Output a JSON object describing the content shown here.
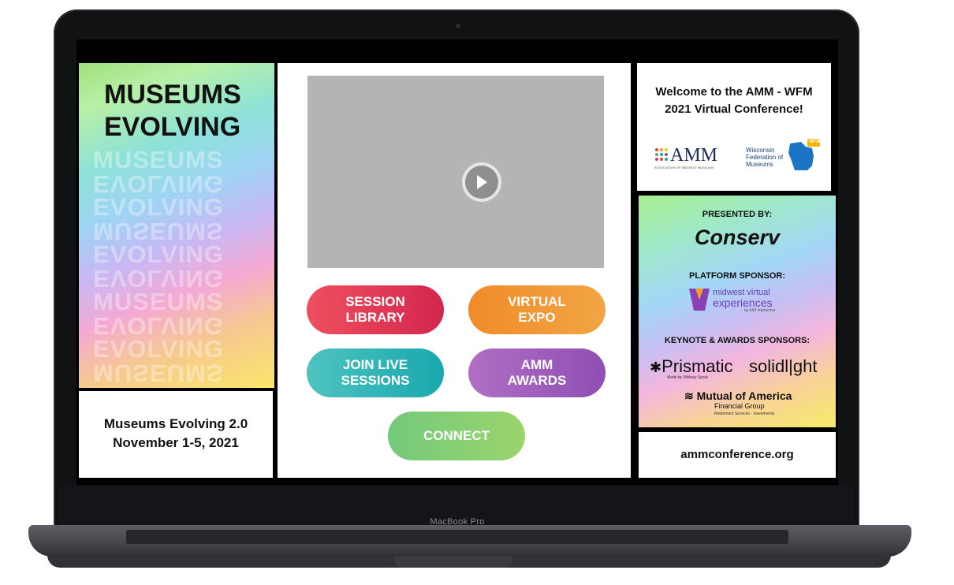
{
  "device": {
    "label": "MacBook Pro"
  },
  "hero": {
    "title_line1": "MUSEUMS",
    "title_line2": "EVOLVING",
    "echo_lines": [
      "MUSEUMS",
      "EVOLVING",
      "EVOLVING",
      "MUSEUMS",
      "EVOLVING",
      "EVOLVING",
      "MUSEUMS",
      "EVOLVING",
      "EVOLVING",
      "MUSEUMS"
    ]
  },
  "event": {
    "name": "Museums Evolving 2.0",
    "dates": "November 1-5, 2021"
  },
  "video": {
    "play_icon": "play-icon"
  },
  "buttons": {
    "session_library": "SESSION\nLIBRARY",
    "virtual_expo": "VIRTUAL\nEXPO",
    "join_live": "JOIN LIVE\nSESSIONS",
    "amm_awards": "AMM\nAWARDS",
    "connect": "CONNECT"
  },
  "welcome": {
    "text": "Welcome to the AMM - WFM 2021 Virtual Conference!",
    "amm_logo": "AMM",
    "amm_logo_sub": "ASSOCIATION OF MIDWEST MUSEUMS",
    "wfm_logo": "Wisconsin Federation of Museums",
    "wfm_badge": "WFM"
  },
  "sponsors": {
    "presented_label": "PRESENTED BY:",
    "presenter": "Conserv",
    "platform_label": "PLATFORM SPONSOR:",
    "platform_line1": "midwest virtual",
    "platform_line2": "experiences",
    "platform_line3": "by AIM interactive",
    "keynote_label": "KEYNOTE & AWARDS SPONSORS:",
    "prismatic": "Prismatic",
    "prismatic_sub": "Made by Midway Spark",
    "solidlight": "solidl|ght",
    "mutual": "Mutual of America",
    "mutual_sub": "Financial Group",
    "mutual_tiny": "Retirement Services · Investments"
  },
  "footer": {
    "url": "ammconference.org"
  },
  "colors": {
    "session": "#e0354f",
    "expo": "#f0922c",
    "live": "#2cb3b4",
    "awards": "#9b58b9",
    "connect": "#85cf74"
  }
}
